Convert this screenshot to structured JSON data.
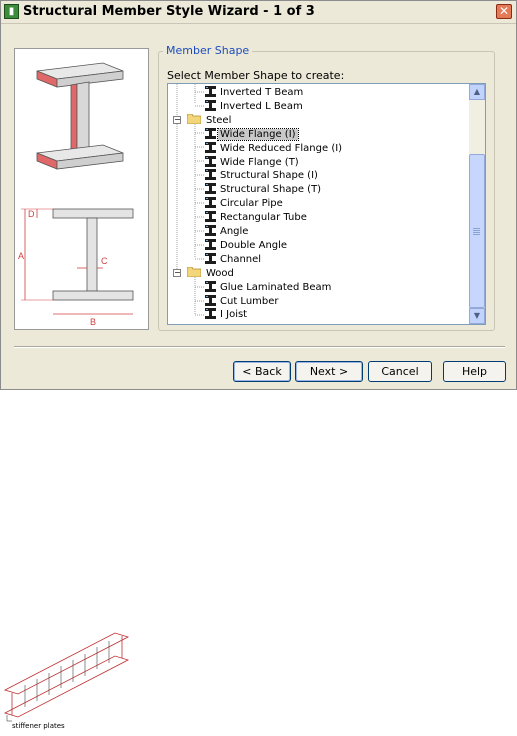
{
  "window": {
    "title": "Structural Member Style Wizard - 1 of 3",
    "close_glyph": "✕"
  },
  "group": {
    "legend": "Member Shape",
    "prompt": "Select Member Shape to create:"
  },
  "tree": {
    "items": [
      {
        "label": "Inverted T Beam",
        "type": "member"
      },
      {
        "label": "Inverted L Beam",
        "type": "member"
      },
      {
        "label": "Steel",
        "type": "folder",
        "expander": "−"
      },
      {
        "label": "Wide Flange (I)",
        "type": "member",
        "selected": true
      },
      {
        "label": "Wide Reduced Flange (I)",
        "type": "member"
      },
      {
        "label": "Wide Flange (T)",
        "type": "member"
      },
      {
        "label": "Structural Shape (I)",
        "type": "member"
      },
      {
        "label": "Structural Shape (T)",
        "type": "member"
      },
      {
        "label": "Circular Pipe",
        "type": "member"
      },
      {
        "label": "Rectangular Tube",
        "type": "member"
      },
      {
        "label": "Angle",
        "type": "member"
      },
      {
        "label": "Double Angle",
        "type": "member"
      },
      {
        "label": "Channel",
        "type": "member"
      },
      {
        "label": "Wood",
        "type": "folder",
        "expander": "−"
      },
      {
        "label": "Glue Laminated Beam",
        "type": "member"
      },
      {
        "label": "Cut Lumber",
        "type": "member"
      },
      {
        "label": "I Joist",
        "type": "member"
      }
    ],
    "scroll_up_glyph": "▲",
    "scroll_down_glyph": "▼"
  },
  "preview": {
    "dim_a": "A",
    "dim_b": "B",
    "dim_c": "C",
    "dim_d": "D"
  },
  "buttons": {
    "back": "< Back",
    "next": "Next >",
    "cancel": "Cancel",
    "help": "Help"
  },
  "figure": {
    "caption": "stiffener plates"
  },
  "colors": {
    "accent": "#1c4cbc",
    "flange_red": "#e06868",
    "dialog_bg": "#ece9d8"
  }
}
